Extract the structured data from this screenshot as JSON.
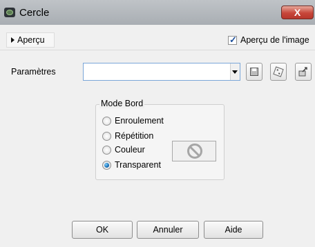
{
  "window": {
    "title": "Cercle",
    "close_label": "X"
  },
  "preview": {
    "toggle_label": "Aperçu",
    "image_checkbox_label": "Aperçu de l'image",
    "image_checkbox_checked": true
  },
  "parameters": {
    "label": "Paramètres",
    "value": ""
  },
  "mode_bord": {
    "title": "Mode Bord",
    "options": [
      {
        "label": "Enroulement",
        "checked": false
      },
      {
        "label": "Répétition",
        "checked": false
      },
      {
        "label": "Couleur",
        "checked": false
      },
      {
        "label": "Transparent",
        "checked": true
      }
    ]
  },
  "buttons": {
    "ok": "OK",
    "cancel": "Annuler",
    "help": "Aide"
  },
  "icons": [
    "camera-icon",
    "close-icon",
    "save-preset-icon",
    "random-icon",
    "reset-icon",
    "no-color-icon"
  ]
}
